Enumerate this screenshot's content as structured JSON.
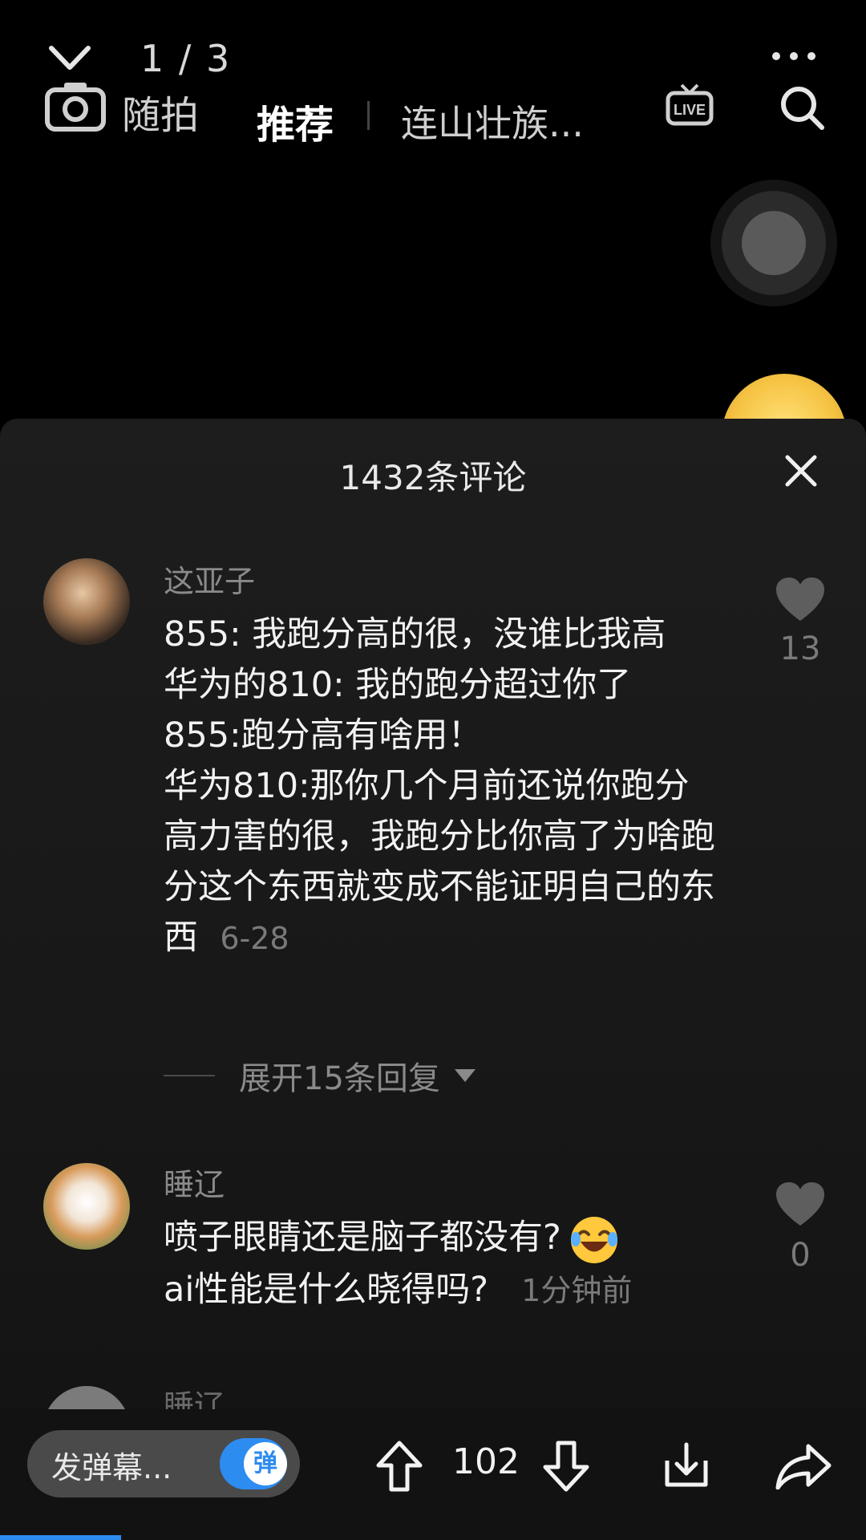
{
  "top": {
    "pager": "1 / 3",
    "camera_label": "随拍",
    "tab_recommended": "推荐",
    "tab_location": "连山壮族..."
  },
  "sheet": {
    "title": "1432条评论",
    "comments": [
      {
        "username": "这亚子",
        "text": "855: 我跑分高的很，没谁比我高\n华为的810: 我的跑分超过你了\n855:跑分高有啥用！\n华为810:那你几个月前还说你跑分高力害的很，我跑分比你高了为啥跑分这个东西就变成不能证明自己的东西",
        "time": "6-28",
        "likes": "13",
        "expand_label": "展开15条回复"
      },
      {
        "username": "睡辽",
        "text": "喷子眼睛还是脑子都没有?",
        "text2": "ai性能是什么晓得吗?",
        "time": "1分钟前",
        "likes": "0"
      },
      {
        "username": "睡辽"
      }
    ]
  },
  "bottom": {
    "danmu_placeholder": "发弹幕...",
    "danmu_toggle": "弹",
    "vote_count": "102",
    "video_progress_percent": 14
  },
  "colors": {
    "accent": "#2d8cf0",
    "background": "#000000",
    "sheet": "#1b1b1b"
  },
  "icons": [
    "chevron-down-icon",
    "more-icon",
    "camera-icon",
    "live-icon",
    "search-icon",
    "close-icon",
    "heart-icon",
    "upvote-icon",
    "downvote-icon",
    "download-icon",
    "share-icon",
    "laughing-emoji-icon"
  ]
}
